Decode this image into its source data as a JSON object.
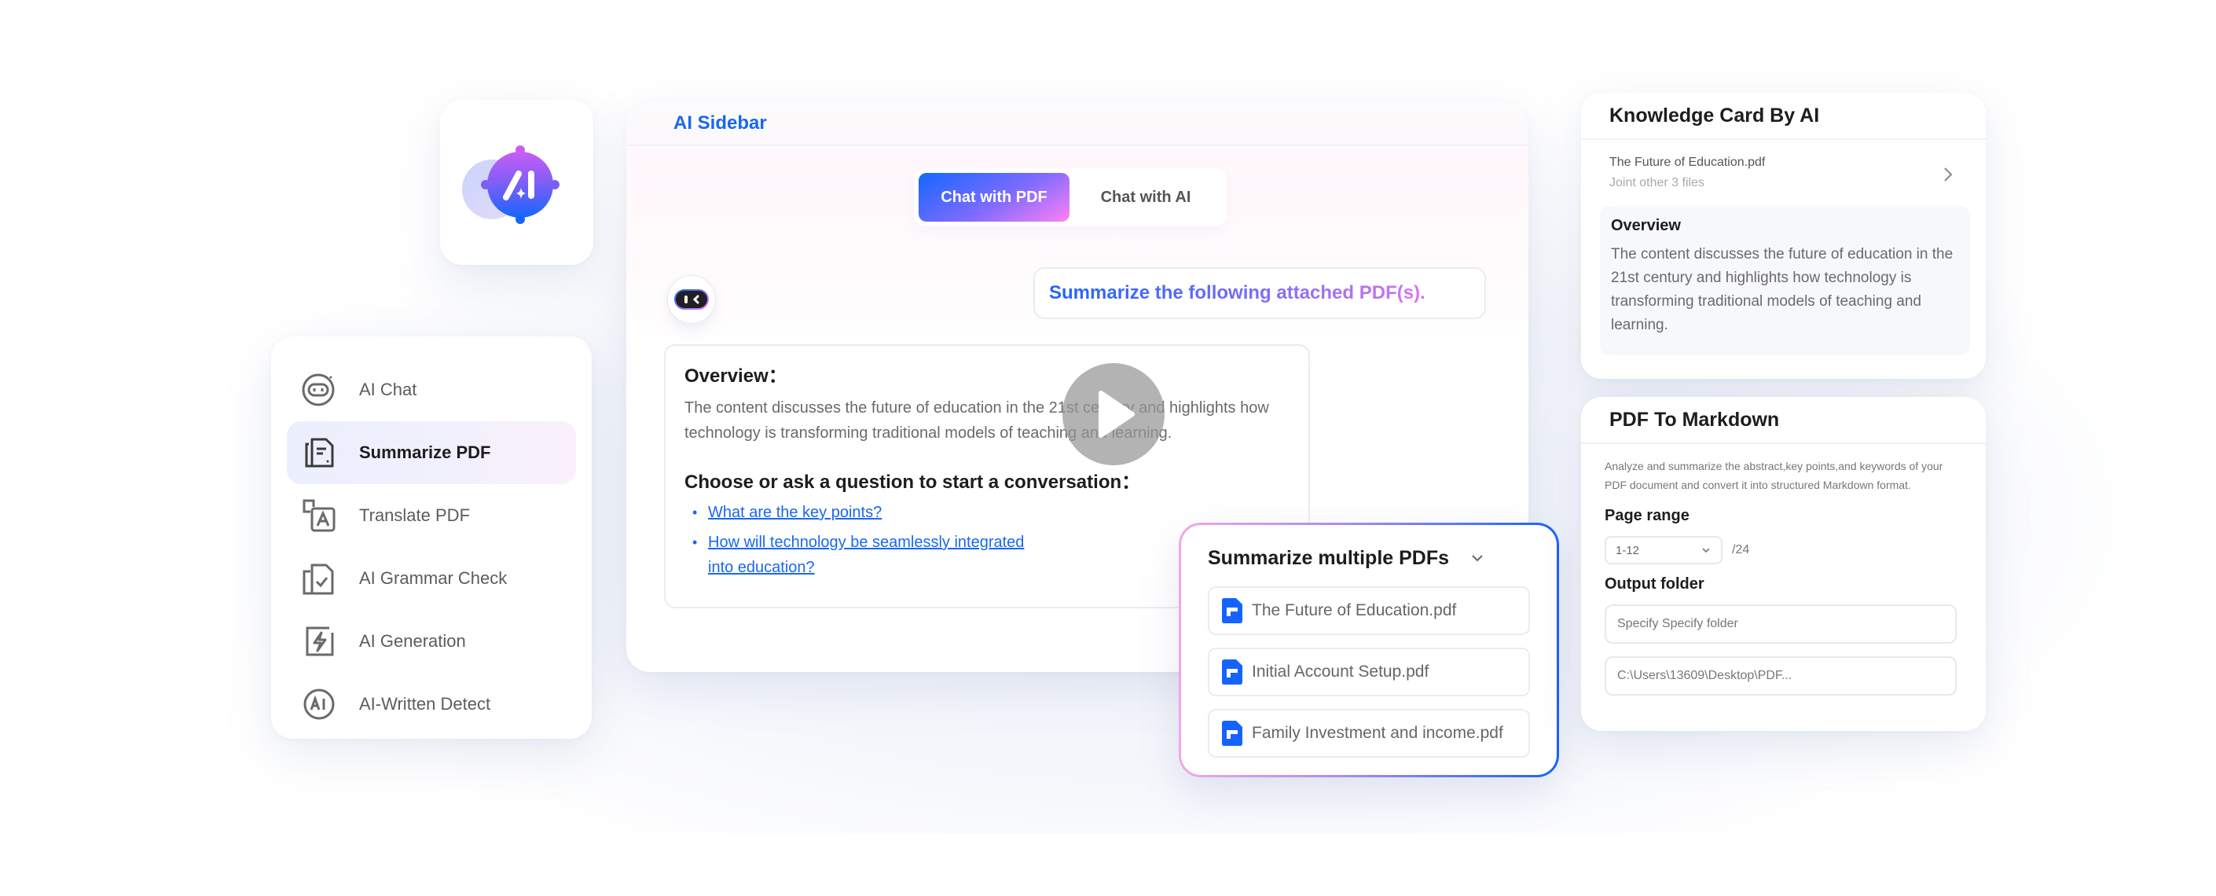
{
  "logo": {
    "icon": "ai-logo-icon",
    "text": "AI"
  },
  "sidebar": {
    "items": [
      {
        "label": "AI Chat",
        "icon": "robot-chat-icon",
        "active": false
      },
      {
        "label": "Summarize PDF",
        "icon": "summarize-doc-icon",
        "active": true
      },
      {
        "label": "Translate PDF",
        "icon": "translate-icon",
        "active": false
      },
      {
        "label": "AI Grammar Check",
        "icon": "grammar-check-icon",
        "active": false
      },
      {
        "label": "AI Generation",
        "icon": "lightning-doc-icon",
        "active": false
      },
      {
        "label": "AI-Written Detect",
        "icon": "ai-detect-icon",
        "active": false
      }
    ]
  },
  "main": {
    "title": "AI Sidebar",
    "tabs": [
      {
        "label": "Chat with PDF",
        "active": true
      },
      {
        "label": "Chat with AI",
        "active": false
      }
    ],
    "user_message": "Summarize the following attached PDF(s).",
    "answer": {
      "overview_heading": "Overview：",
      "overview_text": "The content discusses the future of education in the 21st century and highlights how technology is transforming traditional models of teaching and learning.",
      "questions_heading": "Choose or ask a question to start a conversation：",
      "questions": [
        "What are the key points?",
        "How will technology be seamlessly integrated into education?"
      ]
    },
    "play_button": "play-icon"
  },
  "multi_pdf": {
    "title": "Summarize multiple PDFs",
    "files": [
      "The Future of Education.pdf",
      "Initial Account Setup.pdf",
      "Family Investment and income.pdf"
    ]
  },
  "knowledge_card": {
    "title": "Knowledge Card By AI",
    "file_name": "The Future of Education.pdf",
    "file_sub": "Joint other 3 files",
    "overview_heading": "Overview",
    "overview_text": "The content discusses the future of education in the 21st century and highlights how technology is transforming traditional models of teaching and learning."
  },
  "markdown": {
    "title": "PDF To Markdown",
    "description": "Analyze and summarize the abstract,key points,and keywords of your PDF document and convert it into structured Markdown format.",
    "page_range_label": "Page range",
    "page_range_value": "1-12",
    "page_total": "/24",
    "output_label": "Output folder",
    "folder_placeholder": "Specify Specify folder",
    "folder_path": "C:\\Users\\13609\\Desktop\\PDF..."
  },
  "colors": {
    "accent_blue": "#1967f2",
    "gradient_pink": "#ff7ff5",
    "file_icon_blue": "#1563ff"
  }
}
